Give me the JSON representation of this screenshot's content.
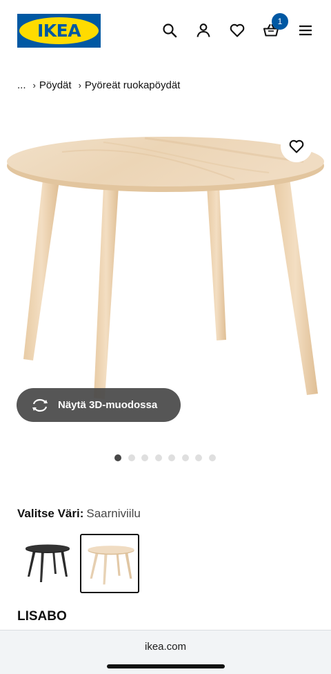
{
  "header": {
    "logo_text": "IKEA",
    "logo_reg": "®",
    "cart_count": "1",
    "brand_blue": "#0058a3",
    "brand_yellow": "#ffdb00",
    "icons": [
      "search-icon",
      "account-icon",
      "heart-icon",
      "cart-icon",
      "menu-icon"
    ]
  },
  "breadcrumb": {
    "ellipsis": "...",
    "items": [
      "Pöydät",
      "Pyöreät ruokapöydät"
    ]
  },
  "product": {
    "view_3d_label": "Näytä 3D-muodossa",
    "image_count": 8,
    "active_image": 1,
    "color_label": "Valitse Väri:",
    "color_value": "Saarniviilu",
    "swatches": [
      {
        "name": "black",
        "color": "#2b2b2b",
        "selected": false
      },
      {
        "name": "ash",
        "color": "#e6cfb1",
        "selected": true
      }
    ],
    "name": "LISABO"
  },
  "browser": {
    "url": "ikea.com"
  }
}
